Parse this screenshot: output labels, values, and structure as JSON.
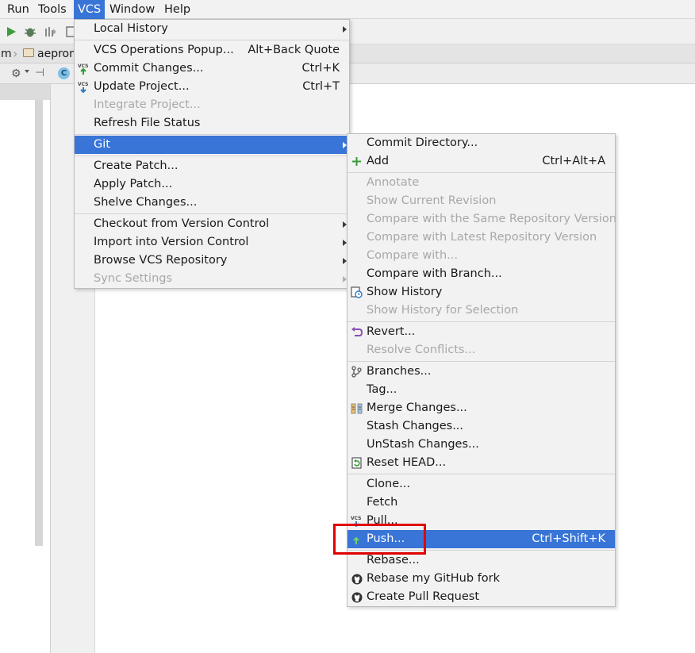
{
  "menubar": {
    "items": [
      "Run",
      "Tools",
      "VCS",
      "Window",
      "Help"
    ]
  },
  "navbar": {
    "crumb_left": "m",
    "crumb_project": "aepron"
  },
  "vcs_menu": {
    "local_history": "Local History",
    "operations_popup": "VCS Operations Popup...",
    "operations_popup_shortcut": "Alt+Back Quote",
    "commit_changes": "Commit Changes...",
    "commit_changes_shortcut": "Ctrl+K",
    "update_project": "Update Project...",
    "update_project_shortcut": "Ctrl+T",
    "integrate_project": "Integrate Project...",
    "refresh_file_status": "Refresh File Status",
    "git": "Git",
    "create_patch": "Create Patch...",
    "apply_patch": "Apply Patch...",
    "shelve_changes": "Shelve Changes...",
    "checkout": "Checkout from Version Control",
    "import": "Import into Version Control",
    "browse_repo": "Browse VCS Repository",
    "sync_settings": "Sync Settings"
  },
  "git_menu": {
    "commit_directory": "Commit Directory...",
    "add": "Add",
    "add_shortcut": "Ctrl+Alt+A",
    "annotate": "Annotate",
    "show_current_revision": "Show Current Revision",
    "compare_same_repo": "Compare with the Same Repository Version",
    "compare_latest_repo": "Compare with Latest Repository Version",
    "compare_with": "Compare with...",
    "compare_with_branch": "Compare with Branch...",
    "show_history": "Show History",
    "show_history_selection": "Show History for Selection",
    "revert": "Revert...",
    "resolve_conflicts": "Resolve Conflicts...",
    "branches": "Branches...",
    "tag": "Tag...",
    "merge_changes": "Merge Changes...",
    "stash_changes": "Stash Changes...",
    "unstash_changes": "UnStash Changes...",
    "reset_head": "Reset HEAD...",
    "clone": "Clone...",
    "fetch": "Fetch",
    "pull": "Pull...",
    "push": "Push...",
    "push_shortcut": "Ctrl+Shift+K",
    "rebase": "Rebase...",
    "rebase_github_fork": "Rebase my GitHub fork",
    "create_pull_request": "Create Pull Request"
  },
  "colors": {
    "selection": "#3875d7",
    "highlight_box": "#e00000",
    "menu_bg": "#f2f2f2",
    "disabled_text": "#a8a8a8"
  },
  "icons": {
    "commit": "vcs-commit-icon",
    "update": "vcs-update-icon",
    "add": "plus-icon",
    "compare_branch": "compare-icon",
    "show_history": "history-icon",
    "revert": "revert-icon",
    "branches": "branch-icon",
    "merge": "merge-icon",
    "reset": "reset-icon",
    "pull": "vcs-pull-icon",
    "push": "vcs-push-icon",
    "github": "github-icon"
  }
}
